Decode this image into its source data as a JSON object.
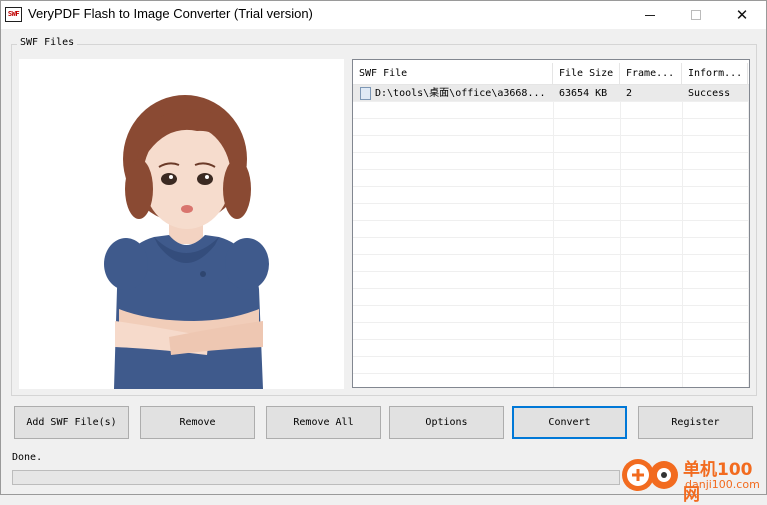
{
  "window": {
    "title": "VeryPDF Flash to Image Converter (Trial version)",
    "app_icon_text": "SWF"
  },
  "group": {
    "label": "SWF Files"
  },
  "preview": {
    "description_icon": "woman-portrait-image"
  },
  "list": {
    "columns": [
      "SWF File",
      "File Size",
      "Frame...",
      "Inform..."
    ],
    "rows": [
      {
        "file": "D:\\tools\\桌面\\office\\a3668...",
        "size": "63654 KB",
        "frames": "2",
        "info": "Success"
      }
    ]
  },
  "buttons": {
    "add": "Add SWF File(s)",
    "remove": "Remove",
    "remove_all": "Remove All",
    "options": "Options",
    "convert": "Convert",
    "register": "Register"
  },
  "status": {
    "text": "Done.",
    "progress": 0
  },
  "watermark": {
    "title": "单机100网",
    "url": "danji100.com"
  },
  "colors": {
    "accent": "#0078d7",
    "watermark": "#f26b1f"
  }
}
